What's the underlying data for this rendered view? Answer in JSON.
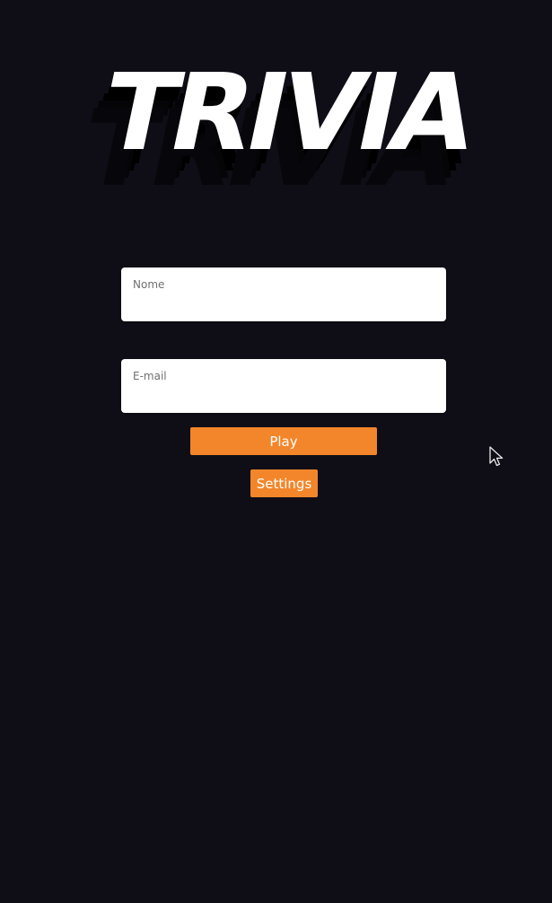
{
  "logo": {
    "text": "TRIVIA",
    "icon": "trivia-logo"
  },
  "form": {
    "name_field": {
      "label": "Nome",
      "value": ""
    },
    "email_field": {
      "label": "E-mail",
      "value": ""
    },
    "play_label": "Play",
    "settings_label": "Settings"
  },
  "colors": {
    "background": "#0f0e17",
    "accent": "#f3862a",
    "logo_face": "#ffffff",
    "logo_shadow": "#000000"
  },
  "cursor": {
    "icon": "mouse-pointer-icon"
  }
}
